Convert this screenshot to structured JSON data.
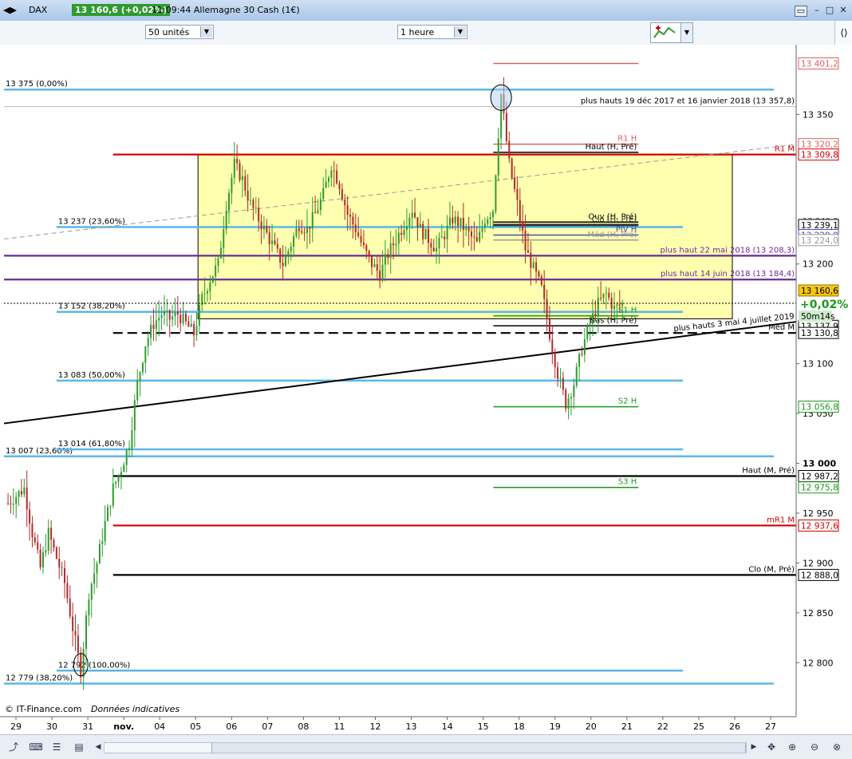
{
  "window": {
    "symbol": "DAX",
    "last_price_badge": "13 160,6 (+0,02%)",
    "time_and_name": "11:09:44 Allemagne 30 Cash (1€)"
  },
  "toolbar": {
    "units_select": "50 unités",
    "interval_select": "1 heure"
  },
  "chart_data": {
    "type": "candlestick",
    "y_axis": {
      "min": 12765,
      "max": 13420,
      "ticks": [
        13350,
        13200,
        13100,
        13050,
        13000,
        12950,
        12900,
        12850,
        12800
      ],
      "tick_labels": [
        "13 350",
        "13 200",
        "13 100",
        "13 050",
        "13 000",
        "12 950",
        "12 900",
        "12 850",
        "12 800"
      ],
      "bold_tick": "13 000"
    },
    "x_axis": {
      "labels": [
        "29",
        "30",
        "31",
        "nov.",
        "04",
        "05",
        "06",
        "07",
        "08",
        "11",
        "12",
        "13",
        "14",
        "15",
        "18",
        "19",
        "20",
        "21",
        "22",
        "25",
        "26",
        "27"
      ]
    },
    "price_path": [
      [
        0,
        12960
      ],
      [
        2,
        12975
      ],
      [
        3,
        12930
      ],
      [
        4,
        12895
      ],
      [
        5,
        12930
      ],
      [
        6,
        12905
      ],
      [
        7,
        12880
      ],
      [
        8,
        12835
      ],
      [
        9,
        12792
      ],
      [
        10,
        12870
      ],
      [
        11,
        12900
      ],
      [
        12,
        12940
      ],
      [
        13,
        12975
      ],
      [
        14,
        12995
      ],
      [
        15,
        13020
      ],
      [
        16,
        13080
      ],
      [
        17,
        13120
      ],
      [
        18,
        13140
      ],
      [
        19,
        13150
      ],
      [
        20,
        13145
      ],
      [
        21,
        13150
      ],
      [
        22,
        13140
      ],
      [
        23,
        13130
      ],
      [
        24,
        13165
      ],
      [
        25,
        13185
      ],
      [
        26,
        13200
      ],
      [
        27,
        13260
      ],
      [
        28,
        13300
      ],
      [
        29,
        13285
      ],
      [
        30,
        13260
      ],
      [
        31,
        13245
      ],
      [
        32,
        13230
      ],
      [
        33,
        13215
      ],
      [
        34,
        13200
      ],
      [
        35,
        13220
      ],
      [
        36,
        13240
      ],
      [
        37,
        13235
      ],
      [
        38,
        13250
      ],
      [
        39,
        13270
      ],
      [
        40,
        13300
      ],
      [
        41,
        13280
      ],
      [
        42,
        13250
      ],
      [
        43,
        13235
      ],
      [
        44,
        13215
      ],
      [
        45,
        13200
      ],
      [
        46,
        13190
      ],
      [
        47,
        13210
      ],
      [
        48,
        13225
      ],
      [
        49,
        13240
      ],
      [
        50,
        13255
      ],
      [
        51,
        13235
      ],
      [
        52,
        13225
      ],
      [
        53,
        13215
      ],
      [
        54,
        13230
      ],
      [
        55,
        13245
      ],
      [
        56,
        13240
      ],
      [
        57,
        13230
      ],
      [
        58,
        13220
      ],
      [
        59,
        13245
      ],
      [
        60,
        13255
      ],
      [
        61,
        13370
      ],
      [
        62,
        13300
      ],
      [
        63,
        13260
      ],
      [
        64,
        13215
      ],
      [
        65,
        13195
      ],
      [
        66,
        13175
      ],
      [
        67,
        13130
      ],
      [
        68,
        13090
      ],
      [
        69,
        13060
      ],
      [
        70,
        13080
      ],
      [
        71,
        13115
      ],
      [
        72,
        13140
      ],
      [
        73,
        13160
      ],
      [
        74,
        13170
      ],
      [
        75,
        13155
      ],
      [
        76,
        13160
      ]
    ],
    "total_slots": 98,
    "horizontal_levels": [
      {
        "value": 13375,
        "label": "13 375 (0,00%)",
        "color": "#5bb7e8"
      },
      {
        "value": 13007,
        "label": "13 007 (23,60%)",
        "color": "#5bb7e8"
      },
      {
        "value": 12779,
        "label": "12 779 (38,20%)",
        "color": "#5bb7e8"
      },
      {
        "value": 13237,
        "label": "13 237 (23,60%)",
        "color": "#5bb7e8"
      },
      {
        "value": 13152,
        "label": "13 152 (38,20%)",
        "color": "#5bb7e8"
      },
      {
        "value": 13083,
        "label": "13 083 (50,00%)",
        "color": "#5bb7e8"
      },
      {
        "value": 13014,
        "label": "13 014 (61,80%)",
        "color": "#5bb7e8"
      },
      {
        "value": 12792,
        "label": "12 792 (100,00%)",
        "color": "#5bb7e8"
      },
      {
        "value": 13309.8,
        "label": "R1 M",
        "color": "#d20000"
      },
      {
        "value": 12937.6,
        "label": "mR1 M",
        "color": "#d20000"
      },
      {
        "value": 13208.3,
        "label": "plus haut 22 mai 2018 (13 208,3)",
        "color": "#6a2b9a"
      },
      {
        "value": 13184.4,
        "label": "plus haut 14 juin 2018 (13 184,4)",
        "color": "#6a2b9a"
      },
      {
        "value": 12987.2,
        "label": "Haut (M, Pré)",
        "color": "#000000"
      },
      {
        "value": 12888.0,
        "label": "Clo (M, Pré)",
        "color": "#000000"
      },
      {
        "value": 13130.8,
        "label": "Méd M",
        "color": "#000000"
      }
    ],
    "daily_levels": [
      {
        "value": 13401.2,
        "label": "",
        "color": "#e06060"
      },
      {
        "value": 13320.2,
        "label": "R1 H",
        "color": "#e06060"
      },
      {
        "value": 13312.0,
        "label": "Haut (H, Pré)",
        "color": "#000000"
      },
      {
        "value": 13242.0,
        "label": "Ouv (H, Pré)",
        "color": "#000000"
      },
      {
        "value": 13239.1,
        "label": "Clo (H, Pré)",
        "color": "#333333"
      },
      {
        "value": 13229.0,
        "label": "PIV H",
        "color": "#4a4ac0"
      },
      {
        "value": 13224.0,
        "label": "Méd (H, Pré)",
        "color": "#999999"
      },
      {
        "value": 13148.0,
        "label": "S1 H",
        "color": "#1a9a1a"
      },
      {
        "value": 13137.9,
        "label": "Bas (H, Pré)",
        "color": "#000000"
      },
      {
        "value": 13056.8,
        "label": "S2 H",
        "color": "#1a9a1a"
      },
      {
        "value": 12975.8,
        "label": "S3 H",
        "color": "#1a9a1a"
      }
    ],
    "annotations": {
      "highs_note": "plus hauts 19 déc 2017 et 16 janvier 2018 (13 357,8)",
      "trendline_note": "plus hauts 3 mai 4 juillet 2019",
      "last_price": "13 160,6",
      "change": "+0,02%",
      "countdown": "50m14s",
      "watermark": "© IT-Finance.com",
      "watermark_note": "Données indicatives"
    },
    "axis_badges": [
      {
        "value": 13401.2,
        "text": "13 401,2",
        "color": "#e06060",
        "bg": "#ffffff"
      },
      {
        "value": 13320.2,
        "text": "13 320,2",
        "color": "#e06060",
        "bg": "#ffffff"
      },
      {
        "value": 13309.8,
        "text": "13 309,8",
        "color": "#d20000",
        "bg": "#ffffff"
      },
      {
        "value": 13239.1,
        "text": "13 239,1",
        "color": "#000000",
        "bg": "#ffffff"
      },
      {
        "value": 13229.0,
        "text": "13 229,0",
        "color": "#4a4ac0",
        "bg": "#ffffff"
      },
      {
        "value": 13224.0,
        "text": "13 224,0",
        "color": "#999999",
        "bg": "#ffffff"
      },
      {
        "value": 13137.9,
        "text": "13 137,9",
        "color": "#000000",
        "bg": "#ffffff"
      },
      {
        "value": 13130.8,
        "text": "13 130,8",
        "color": "#000000",
        "bg": "#ffffff"
      },
      {
        "value": 13056.8,
        "text": "13 056,8",
        "color": "#1a9a1a",
        "bg": "#ffffff"
      },
      {
        "value": 12987.2,
        "text": "12 987,2",
        "color": "#000000",
        "bg": "#ffffff"
      },
      {
        "value": 12975.8,
        "text": "12 975,8",
        "color": "#1a9a1a",
        "bg": "#ffffff"
      },
      {
        "value": 12937.6,
        "text": "12 937,6",
        "color": "#d20000",
        "bg": "#ffffff"
      },
      {
        "value": 12888.0,
        "text": "12 888,0",
        "color": "#000000",
        "bg": "#ffffff"
      }
    ],
    "partial_axis_labels": [
      "13 310,1",
      "13 240,6"
    ],
    "colors": {
      "up": "#2f9a2f",
      "down": "#b02a2a",
      "box": "#ffffb0",
      "trend": "#000000",
      "dashed_trend": "#999999"
    }
  }
}
